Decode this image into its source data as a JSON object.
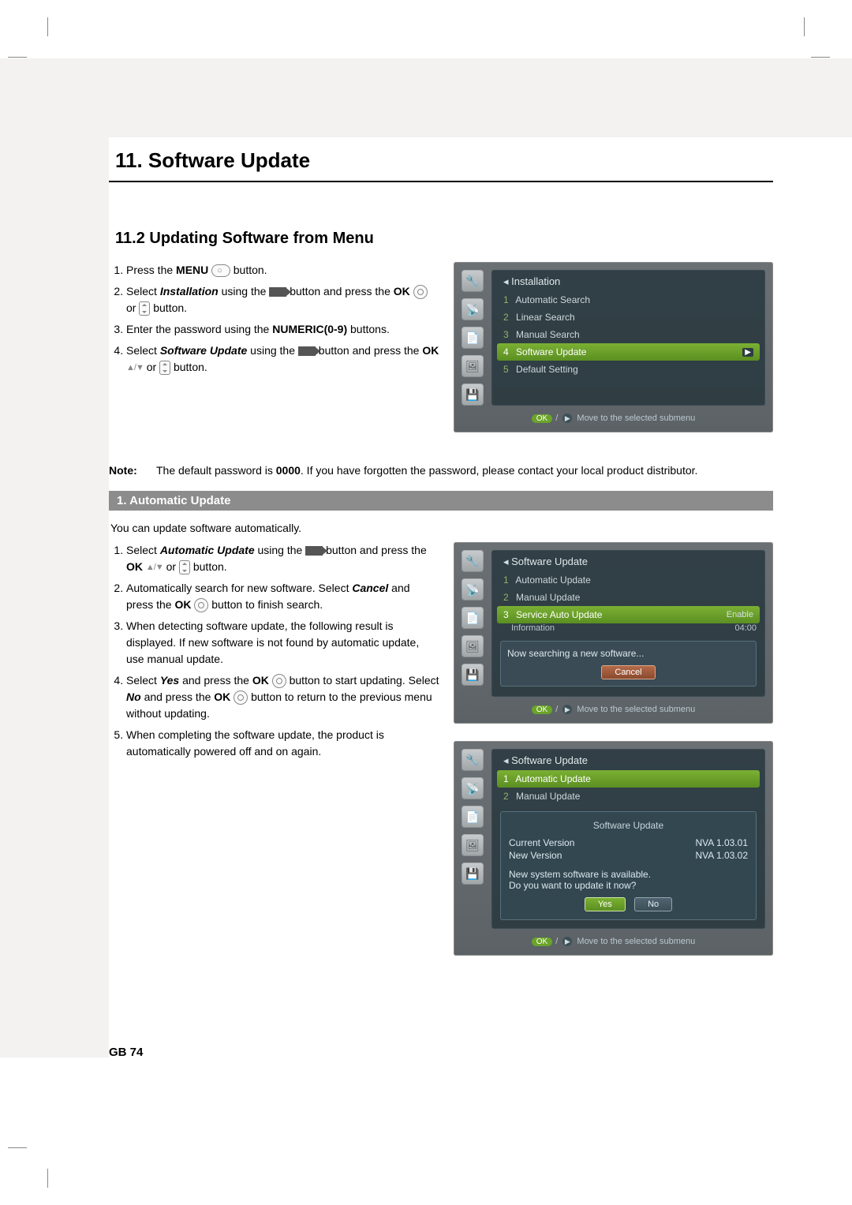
{
  "chapter_title": "11. Software Update",
  "section_title": "11.2 Updating Software from Menu",
  "steps_a": {
    "s1_a": "Press the ",
    "s1_b": "MENU",
    "s1_c": " button.",
    "s2_a": "Select ",
    "s2_b": "Installation",
    "s2_c": " using the ",
    "s2_d": " button and press the ",
    "s2_e": "OK",
    "s2_f": " or ",
    "s2_g": " button.",
    "s3_a": "Enter the password using the ",
    "s3_b": "NUMERIC(0-9)",
    "s3_c": " buttons.",
    "s4_a": "Select ",
    "s4_b": "Software Update",
    "s4_c": " using the ",
    "s4_d": " button and press the ",
    "s4_e": "OK",
    "s4_f": " or ",
    "s4_g": " button."
  },
  "note_label": "Note:",
  "note_text": "The default password is 0000. If you have forgotten the password, please contact your local product distributor.",
  "note_bold": "0000",
  "sub1_title": "1. Automatic Update",
  "sub1_intro": "You can update software automatically.",
  "steps_b": {
    "s1_a": "Select ",
    "s1_b": "Automatic Update",
    "s1_c": " using the ",
    "s1_d": " button and press the ",
    "s1_e": "OK",
    "s1_f": " or ",
    "s1_g": " button.",
    "s2_a": "Automatically search for new software. Select ",
    "s2_b": "Cancel",
    "s2_c": " and press the ",
    "s2_d": "OK",
    "s2_e": " button to finish search.",
    "s3": "When detecting software update, the following result is displayed. If new software is not found by automatic update, use manual update.",
    "s4_a": "Select ",
    "s4_b": "Yes",
    "s4_c": " and press the ",
    "s4_d": "OK",
    "s4_e": " button to start updating. Select ",
    "s4_f": "No",
    "s4_g": " and press the ",
    "s4_h": "OK",
    "s4_i": " button to return to the previous menu without updating.",
    "s5": "When completing the software update, the product is automatically powered off and on again."
  },
  "tv1": {
    "title": "Installation",
    "items": [
      {
        "n": "1",
        "label": "Automatic Search"
      },
      {
        "n": "2",
        "label": "Linear Search"
      },
      {
        "n": "3",
        "label": "Manual Search"
      },
      {
        "n": "4",
        "label": "Software Update"
      },
      {
        "n": "5",
        "label": "Default Setting"
      }
    ],
    "selected_index": 3,
    "foot": "Move to the selected submenu"
  },
  "tv2": {
    "title": "Software Update",
    "items": [
      {
        "n": "1",
        "label": "Automatic Update"
      },
      {
        "n": "2",
        "label": "Manual Update"
      },
      {
        "n": "3",
        "label": "Service Auto Update",
        "right": "Enable"
      }
    ],
    "sub_label": "Information",
    "sub_right": "04:00",
    "selected_index": 2,
    "box_msg": "Now searching a new software...",
    "box_btn": "Cancel",
    "foot": "Move to the selected submenu"
  },
  "tv3": {
    "title": "Software Update",
    "items": [
      {
        "n": "1",
        "label": "Automatic Update"
      },
      {
        "n": "2",
        "label": "Manual Update"
      }
    ],
    "selected_index": 0,
    "info_title": "Software Update",
    "rows": [
      {
        "k": "Current Version",
        "v": "NVA 1.03.01"
      },
      {
        "k": "New Version",
        "v": "NVA 1.03.02"
      }
    ],
    "question1": "New system software is available.",
    "question2": "Do you want to update it now?",
    "btn_yes": "Yes",
    "btn_no": "No",
    "foot": "Move to the selected submenu"
  },
  "foot_ok": "OK",
  "page_footer": "GB 74",
  "icons": {
    "menu": "menu-oval-icon",
    "ok": "ok-circle-icon",
    "arrow": "arrow-right-icon",
    "updown": "up-down-icon",
    "nav_key": "nav-updown-key-icon"
  }
}
